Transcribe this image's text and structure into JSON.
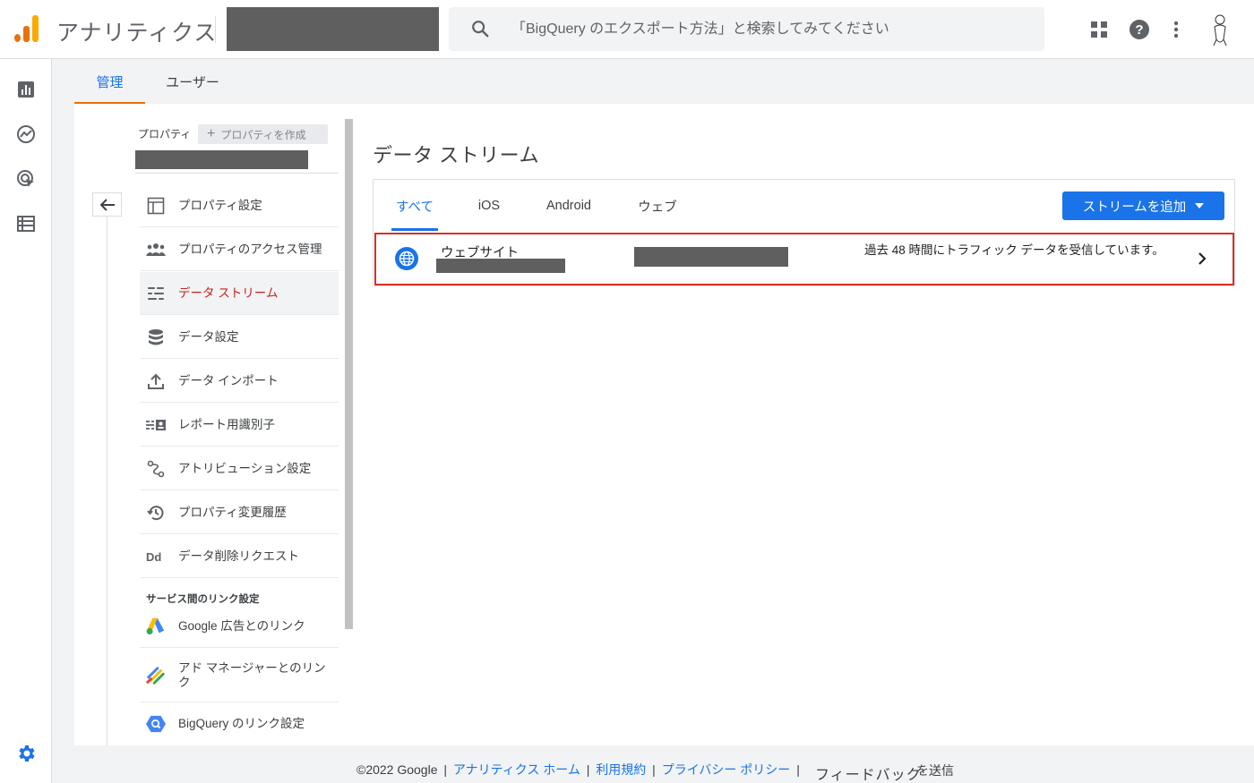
{
  "header": {
    "app_title": "アナリティクス",
    "search_placeholder": "「BigQuery のエクスポート方法」と検索してみてください"
  },
  "admin_tabs": [
    {
      "label": "管理"
    },
    {
      "label": "ユーザー"
    }
  ],
  "property": {
    "label": "プロパティ",
    "create_button": "プロパティを作成"
  },
  "nav": [
    {
      "label": "プロパティ設定",
      "icon": "property-layout-icon"
    },
    {
      "label": "プロパティのアクセス管理",
      "icon": "people-icon"
    },
    {
      "label": "データ ストリーム",
      "icon": "data-streams-icon"
    },
    {
      "label": "データ設定",
      "icon": "database-icon"
    },
    {
      "label": "データ インポート",
      "icon": "upload-icon"
    },
    {
      "label": "レポート用識別子",
      "icon": "identifier-icon"
    },
    {
      "label": "アトリビューション設定",
      "icon": "attribution-icon"
    },
    {
      "label": "プロパティ変更履歴",
      "icon": "history-icon"
    },
    {
      "label": "データ削除リクエスト",
      "icon": "data-deletion-icon"
    }
  ],
  "section_label": "サービス間のリンク設定",
  "links": [
    {
      "label": "Google 広告とのリンク",
      "icon": "google-ads-icon"
    },
    {
      "label": "アド マネージャーとのリンク",
      "icon": "ad-manager-icon"
    },
    {
      "label": "BigQuery のリンク設定",
      "icon": "bigquery-icon"
    }
  ],
  "page_title": "データ ストリーム",
  "filter_tabs": [
    {
      "label": "すべて"
    },
    {
      "label": "iOS"
    },
    {
      "label": "Android"
    },
    {
      "label": "ウェブ"
    }
  ],
  "add_stream_button": "ストリームを追加",
  "stream": {
    "name": "ウェブサイト",
    "status": "過去 48 時間にトラフィック データを受信しています。"
  },
  "footer": {
    "copyright": "©2022 Google",
    "links": [
      "アナリティクス ホーム",
      "利用規約",
      "プライバシー ポリシー"
    ],
    "feedback": "フィードバック",
    "feedback_send": "を送信"
  },
  "colors": {
    "accent": "#1a73e8",
    "active_nav": "#c5221f",
    "highlight_border": "#d93025",
    "tab_indicator": "#e8710a"
  }
}
